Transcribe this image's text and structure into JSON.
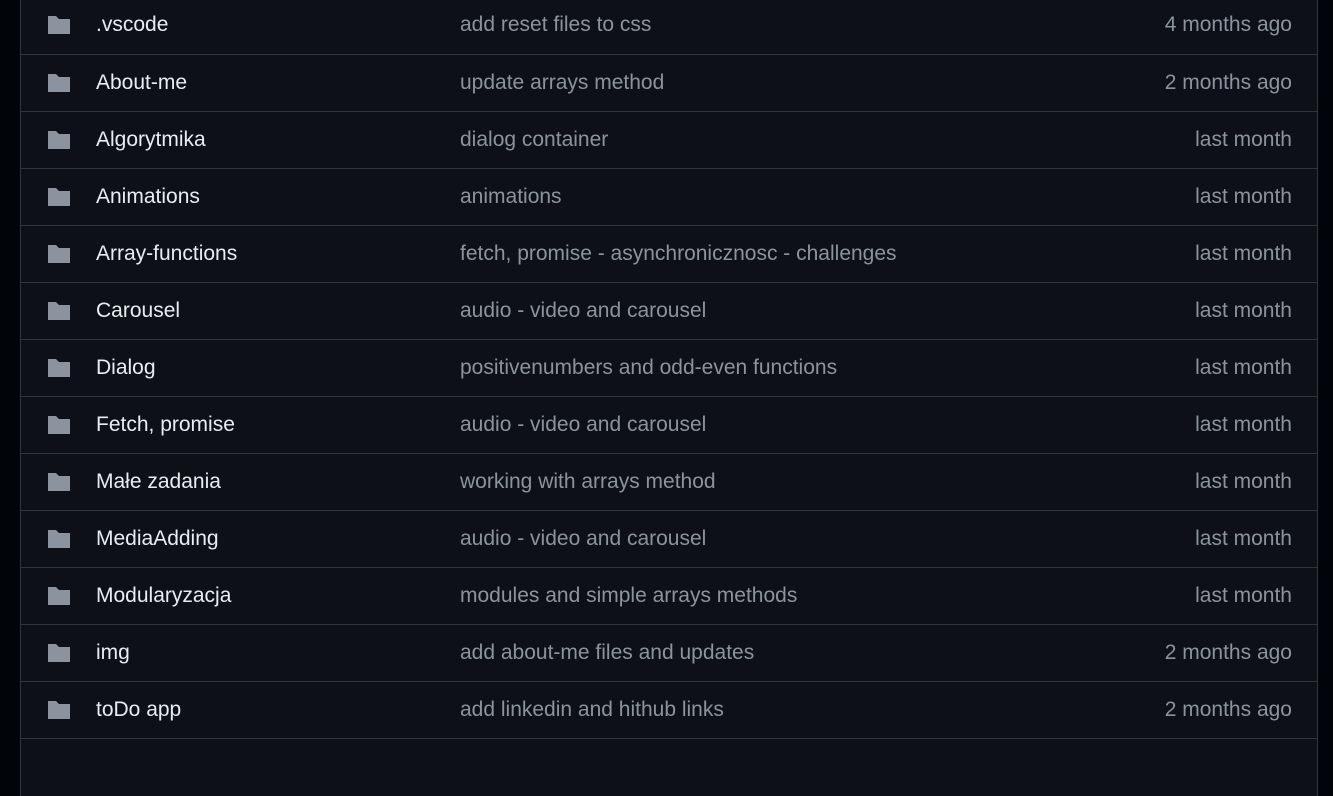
{
  "colors": {
    "background": "#0d1117",
    "border": "#30363d",
    "name_text": "#e6edf3",
    "muted_text": "#8b949e",
    "folder_icon": "#8b949e"
  },
  "files": [
    {
      "icon": "folder-icon",
      "name": ".vscode",
      "commit": "add reset files to css",
      "age": "4 months ago"
    },
    {
      "icon": "folder-icon",
      "name": "About-me",
      "commit": "update arrays method",
      "age": "2 months ago"
    },
    {
      "icon": "folder-icon",
      "name": "Algorytmika",
      "commit": "dialog container",
      "age": "last month"
    },
    {
      "icon": "folder-icon",
      "name": "Animations",
      "commit": "animations",
      "age": "last month"
    },
    {
      "icon": "folder-icon",
      "name": "Array-functions",
      "commit": "fetch, promise - asynchronicznosc - challenges",
      "age": "last month"
    },
    {
      "icon": "folder-icon",
      "name": "Carousel",
      "commit": "audio - video and carousel",
      "age": "last month"
    },
    {
      "icon": "folder-icon",
      "name": "Dialog",
      "commit": "positivenumbers and odd-even functions",
      "age": "last month"
    },
    {
      "icon": "folder-icon",
      "name": "Fetch, promise",
      "commit": "audio - video and carousel",
      "age": "last month"
    },
    {
      "icon": "folder-icon",
      "name": "Małe zadania",
      "commit": "working with arrays method",
      "age": "last month"
    },
    {
      "icon": "folder-icon",
      "name": "MediaAdding",
      "commit": "audio - video and carousel",
      "age": "last month"
    },
    {
      "icon": "folder-icon",
      "name": "Modularyzacja",
      "commit": "modules and simple arrays methods",
      "age": "last month"
    },
    {
      "icon": "folder-icon",
      "name": "img",
      "commit": "add about-me files and updates",
      "age": "2 months ago"
    },
    {
      "icon": "folder-icon",
      "name": "toDo app",
      "commit": "add linkedin and hithub links",
      "age": "2 months ago"
    }
  ]
}
